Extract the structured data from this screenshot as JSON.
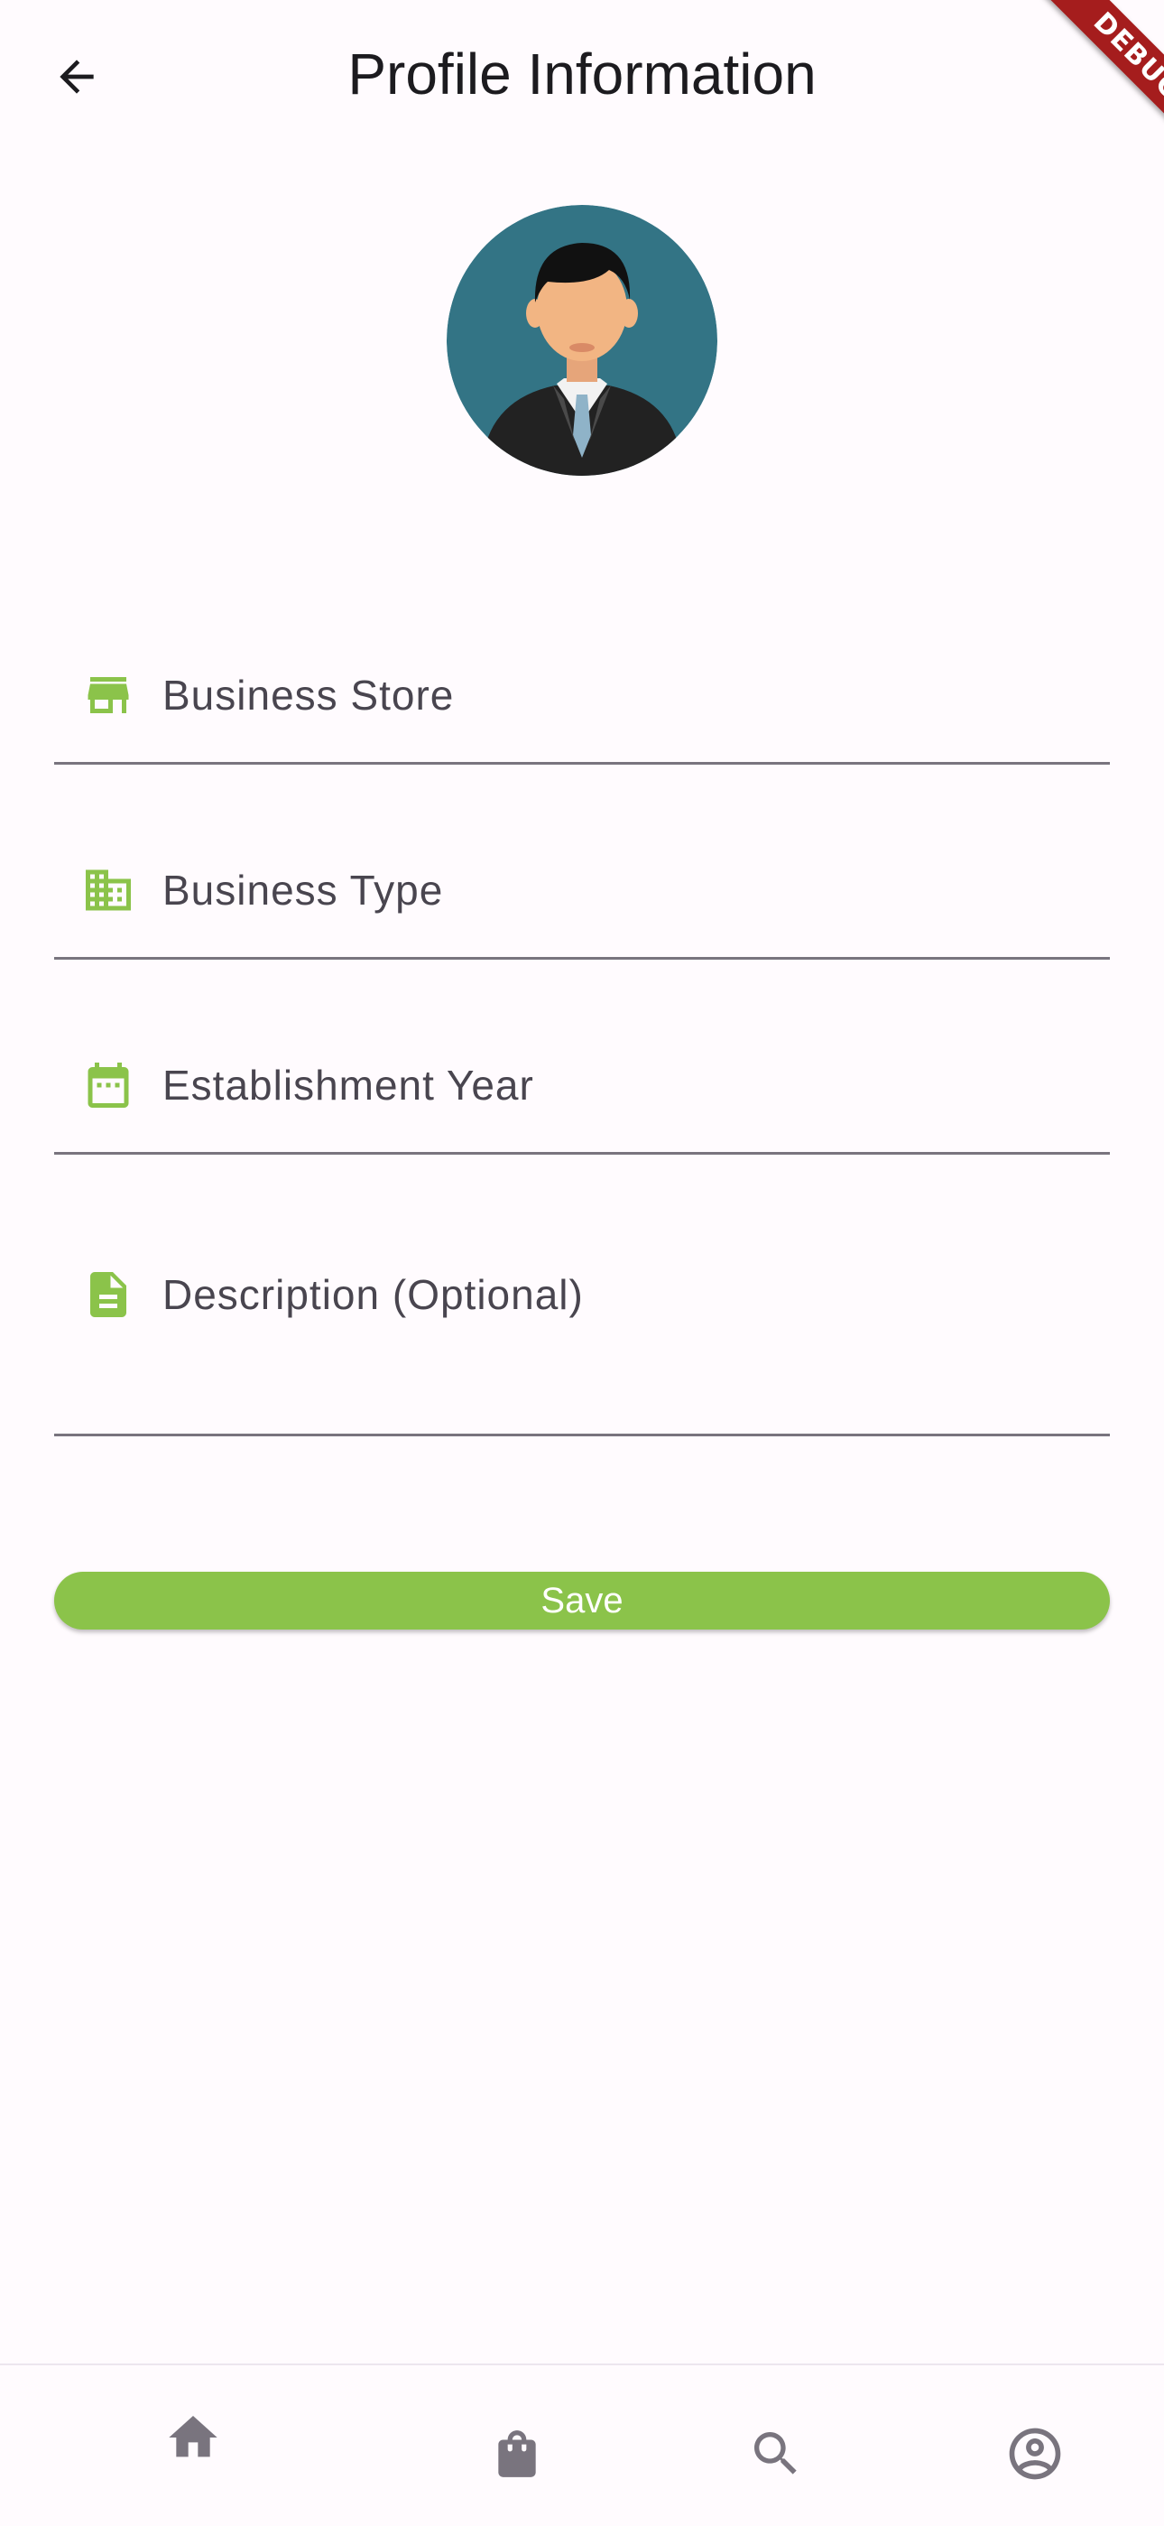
{
  "header": {
    "title": "Profile Information",
    "back_icon": "arrow-back-icon"
  },
  "debug_banner": {
    "label": "DEBUG",
    "color": "#a51d1d"
  },
  "avatar": {
    "icon": "businessman-avatar",
    "background": "#337485"
  },
  "form": {
    "fields": [
      {
        "label": "Business Store",
        "icon": "store-icon"
      },
      {
        "label": "Business Type",
        "icon": "business-building-icon"
      },
      {
        "label": "Establishment Year",
        "icon": "calendar-icon"
      },
      {
        "label": "Description (Optional)",
        "icon": "description-icon"
      }
    ],
    "accent_color": "#8bc34a",
    "save_label": "Save"
  },
  "bottom_nav": {
    "items": [
      {
        "icon": "home-icon"
      },
      {
        "icon": "shopping-bag-icon"
      },
      {
        "icon": "search-icon"
      },
      {
        "icon": "account-circle-icon"
      }
    ]
  }
}
